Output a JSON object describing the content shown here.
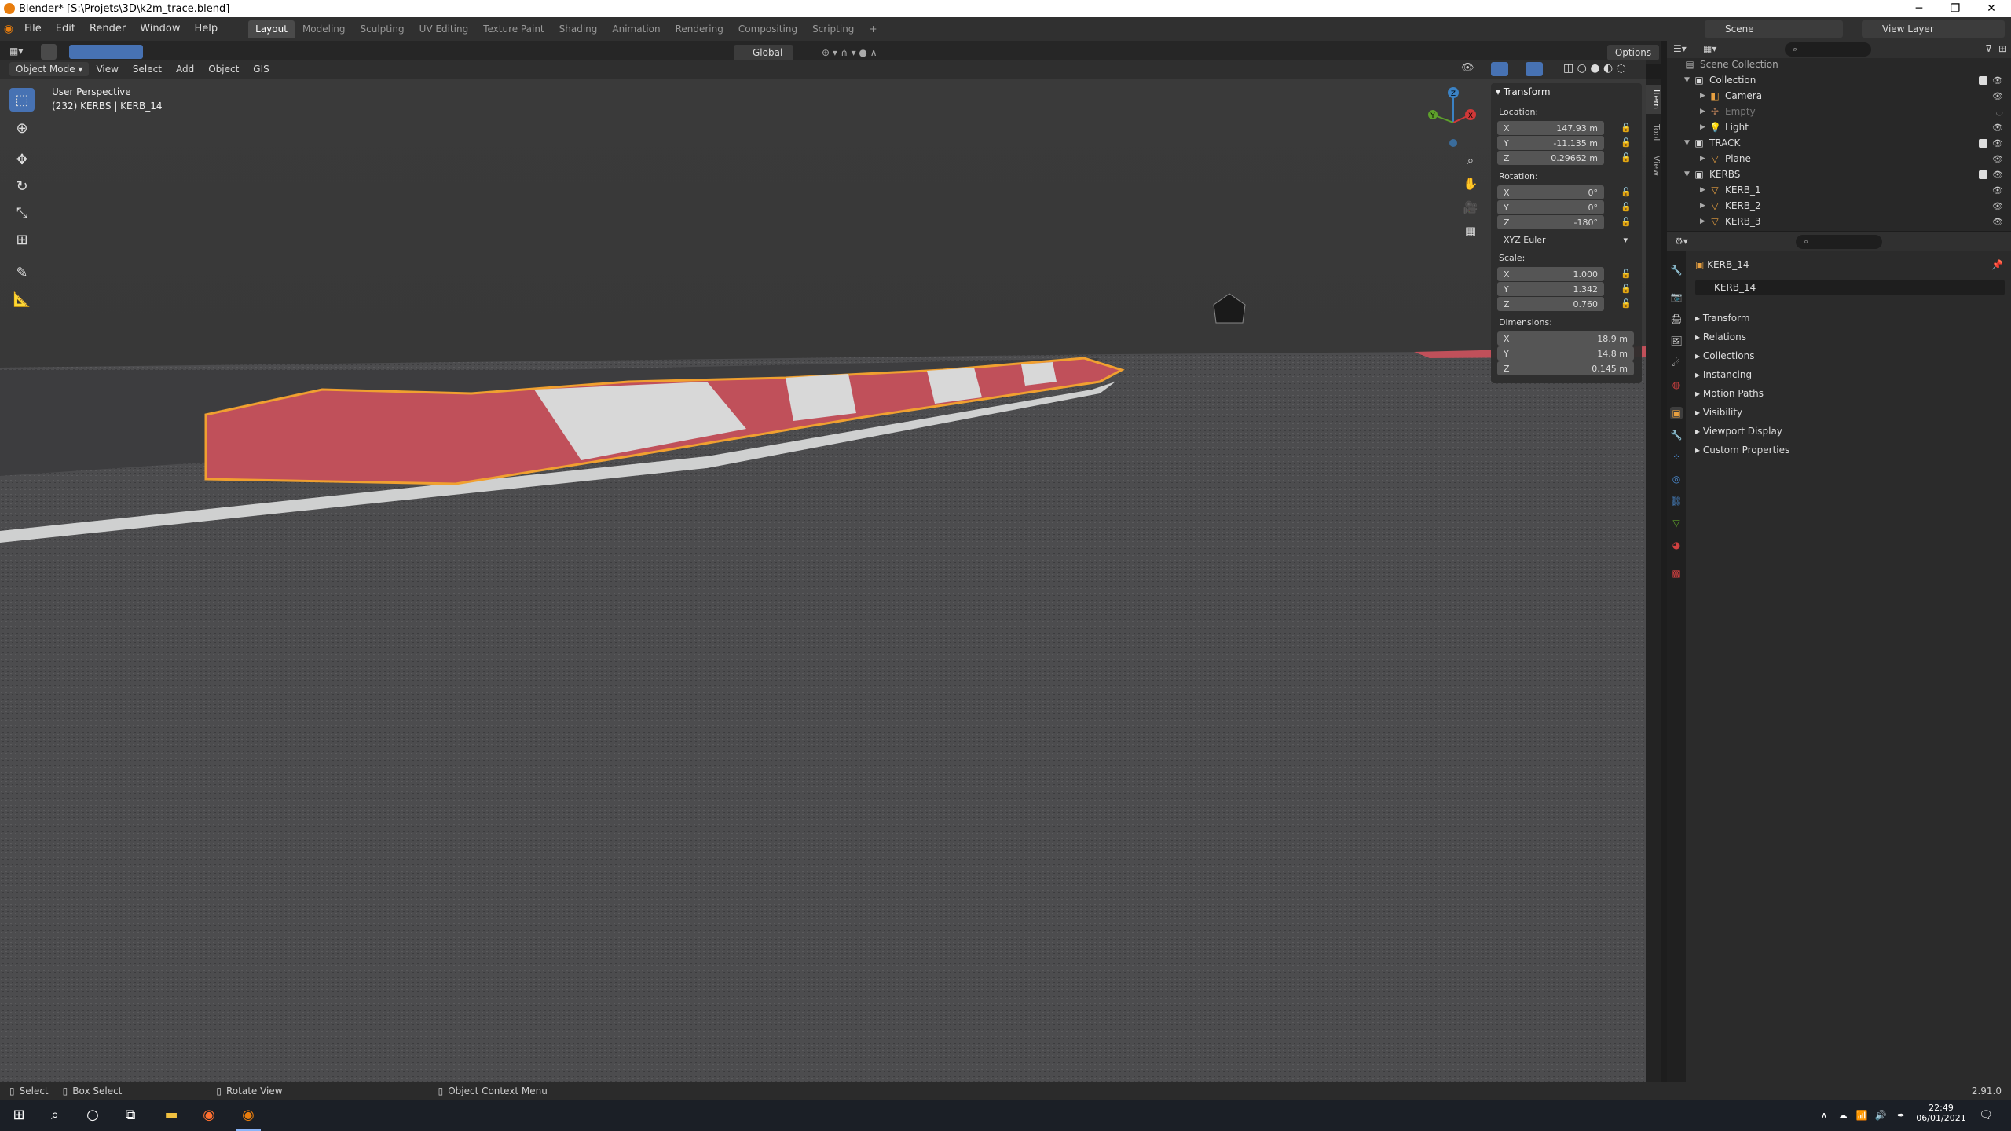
{
  "titlebar": {
    "title": "Blender* [S:\\Projets\\3D\\k2m_trace.blend]"
  },
  "menu": [
    "File",
    "Edit",
    "Render",
    "Window",
    "Help"
  ],
  "workspaces": [
    "Layout",
    "Modeling",
    "Sculpting",
    "UV Editing",
    "Texture Paint",
    "Shading",
    "Animation",
    "Rendering",
    "Compositing",
    "Scripting"
  ],
  "workspace_add": "+",
  "scene": {
    "label": "Scene",
    "view_layer": "View Layer"
  },
  "header2": {
    "transform_orientation": "Global",
    "options": "Options"
  },
  "viewport": {
    "mode": "Object Mode",
    "menus": [
      "View",
      "Select",
      "Add",
      "Object",
      "GIS"
    ],
    "overlay_title": "User Perspective",
    "overlay_sub": "(232) KERBS | KERB_14",
    "gizmo_labels": {
      "x": "X",
      "y": "Y",
      "z": "Z"
    }
  },
  "npanel": {
    "header": "Transform",
    "location_label": "Location:",
    "location": [
      {
        "axis": "X",
        "value": "147.93 m"
      },
      {
        "axis": "Y",
        "value": "-11.135 m"
      },
      {
        "axis": "Z",
        "value": "0.29662 m"
      }
    ],
    "rotation_label": "Rotation:",
    "rotation": [
      {
        "axis": "X",
        "value": "0°"
      },
      {
        "axis": "Y",
        "value": "0°"
      },
      {
        "axis": "Z",
        "value": "-180°"
      }
    ],
    "rotation_mode": "XYZ Euler",
    "scale_label": "Scale:",
    "scale": [
      {
        "axis": "X",
        "value": "1.000"
      },
      {
        "axis": "Y",
        "value": "1.342"
      },
      {
        "axis": "Z",
        "value": "0.760"
      }
    ],
    "dimensions_label": "Dimensions:",
    "dimensions": [
      {
        "axis": "X",
        "value": "18.9 m"
      },
      {
        "axis": "Y",
        "value": "14.8 m"
      },
      {
        "axis": "Z",
        "value": "0.145 m"
      }
    ],
    "tabs": [
      "Item",
      "Tool",
      "View"
    ]
  },
  "outliner": {
    "rows": [
      {
        "label": "Scene Collection",
        "level": 0
      },
      {
        "label": "Collection",
        "level": 1,
        "icon": "collection-icon"
      },
      {
        "label": "Camera",
        "level": 2,
        "icon": "camera-icon"
      },
      {
        "label": "Empty",
        "level": 2,
        "icon": "empty-icon"
      },
      {
        "label": "Light",
        "level": 2,
        "icon": "light-icon"
      },
      {
        "label": "TRACK",
        "level": 1,
        "icon": "collection-icon"
      },
      {
        "label": "Plane",
        "level": 2,
        "icon": "mesh-icon"
      },
      {
        "label": "KERBS",
        "level": 1,
        "icon": "collection-icon"
      },
      {
        "label": "KERB_1",
        "level": 2,
        "icon": "mesh-icon"
      },
      {
        "label": "KERB_2",
        "level": 2,
        "icon": "mesh-icon"
      },
      {
        "label": "KERB_3",
        "level": 2,
        "icon": "mesh-icon"
      }
    ]
  },
  "properties": {
    "object_name": "KERB_14",
    "datablock": "KERB_14",
    "sections": [
      "Transform",
      "Relations",
      "Collections",
      "Instancing",
      "Motion Paths",
      "Visibility",
      "Viewport Display",
      "Custom Properties"
    ]
  },
  "statusbar": {
    "select": "Select",
    "box_select": "Box Select",
    "rotate": "Rotate View",
    "context": "Object Context Menu",
    "version": "2.91.0"
  },
  "taskbar": {
    "time": "22:49",
    "date": "06/01/2021"
  },
  "colors": {
    "accent": "#4772b3",
    "orange": "#e87d0d",
    "kerb_red": "#c0505a",
    "selection": "#f0a030"
  }
}
